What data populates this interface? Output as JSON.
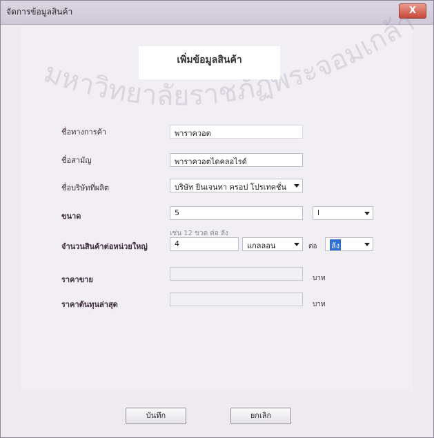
{
  "window": {
    "title": "จัดการข้อมูลสินค้า",
    "close_label": "X"
  },
  "header": {
    "title": "เพิ่มข้อมูลสินค้า"
  },
  "watermark": {
    "text": "มหาวิทยาลัยราชภัฏพระจอมเกล้าเจ้าคุณทหาร"
  },
  "form": {
    "trade_name": {
      "label": "ชื่อทางการค้า",
      "value": "พาราควอต"
    },
    "common_name": {
      "label": "ชื่อสามัญ",
      "value": "พาราควอตไดคลอไรด์"
    },
    "manufacturer": {
      "label": "ชื่อบริษัทที่ผลิต",
      "value": "บริษัท ยินเจนทา ครอป โปรเทคชั่น"
    },
    "size": {
      "label": "ขนาด",
      "value": "5",
      "unit_value": "l"
    },
    "pack": {
      "label": "จำนวนสินค้าต่อหน่วยใหญ่",
      "hint": "เช่น 12 ขวด ต่อ ลัง",
      "value": "4",
      "unit_value": "แกลลอน",
      "per_label": "ต่อ",
      "per_value": "ลัง"
    },
    "sell_price": {
      "label": "ราคาขาย",
      "value": "",
      "unit": "บาท"
    },
    "latest_cost": {
      "label": "ราคาต้นทุนล่าสุด",
      "value": "",
      "unit": "บาท"
    }
  },
  "buttons": {
    "save": "บันทึก",
    "cancel": "ยกเลิก"
  }
}
